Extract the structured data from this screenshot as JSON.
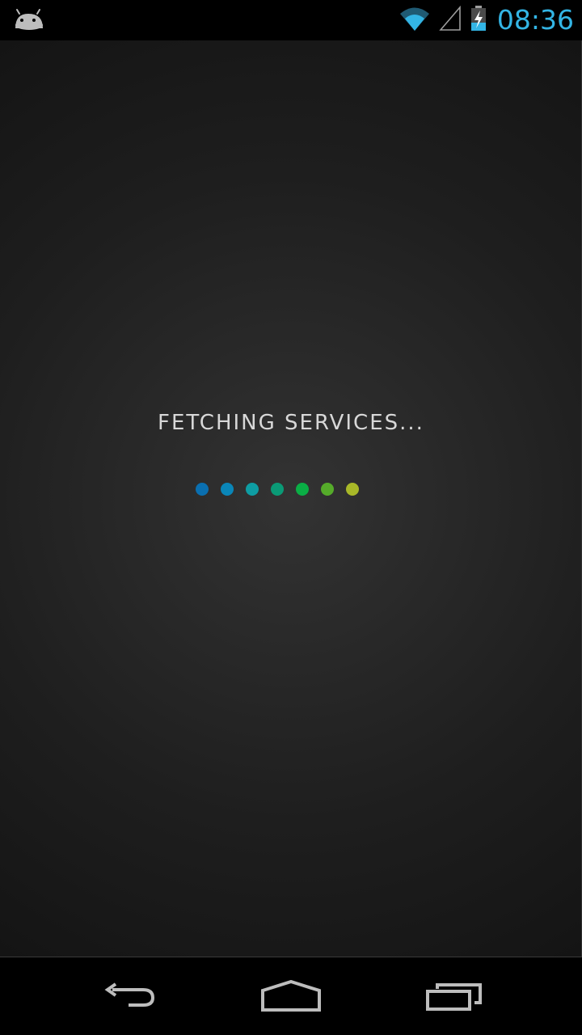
{
  "status_bar": {
    "time": "08:36",
    "left_icon": "android-notification-icon",
    "icons": [
      "wifi-icon",
      "signal-icon",
      "battery-charging-icon"
    ],
    "accent_color": "#33b5e5"
  },
  "main": {
    "loading_text": "FETCHING SERVICES...",
    "dot_colors": [
      "#0a6fb0",
      "#0a86b8",
      "#0e9da3",
      "#0a9a76",
      "#0aae45",
      "#55ab2a",
      "#a8b828"
    ]
  },
  "nav_bar": {
    "buttons": [
      "back-icon",
      "home-icon",
      "recent-apps-icon"
    ]
  }
}
